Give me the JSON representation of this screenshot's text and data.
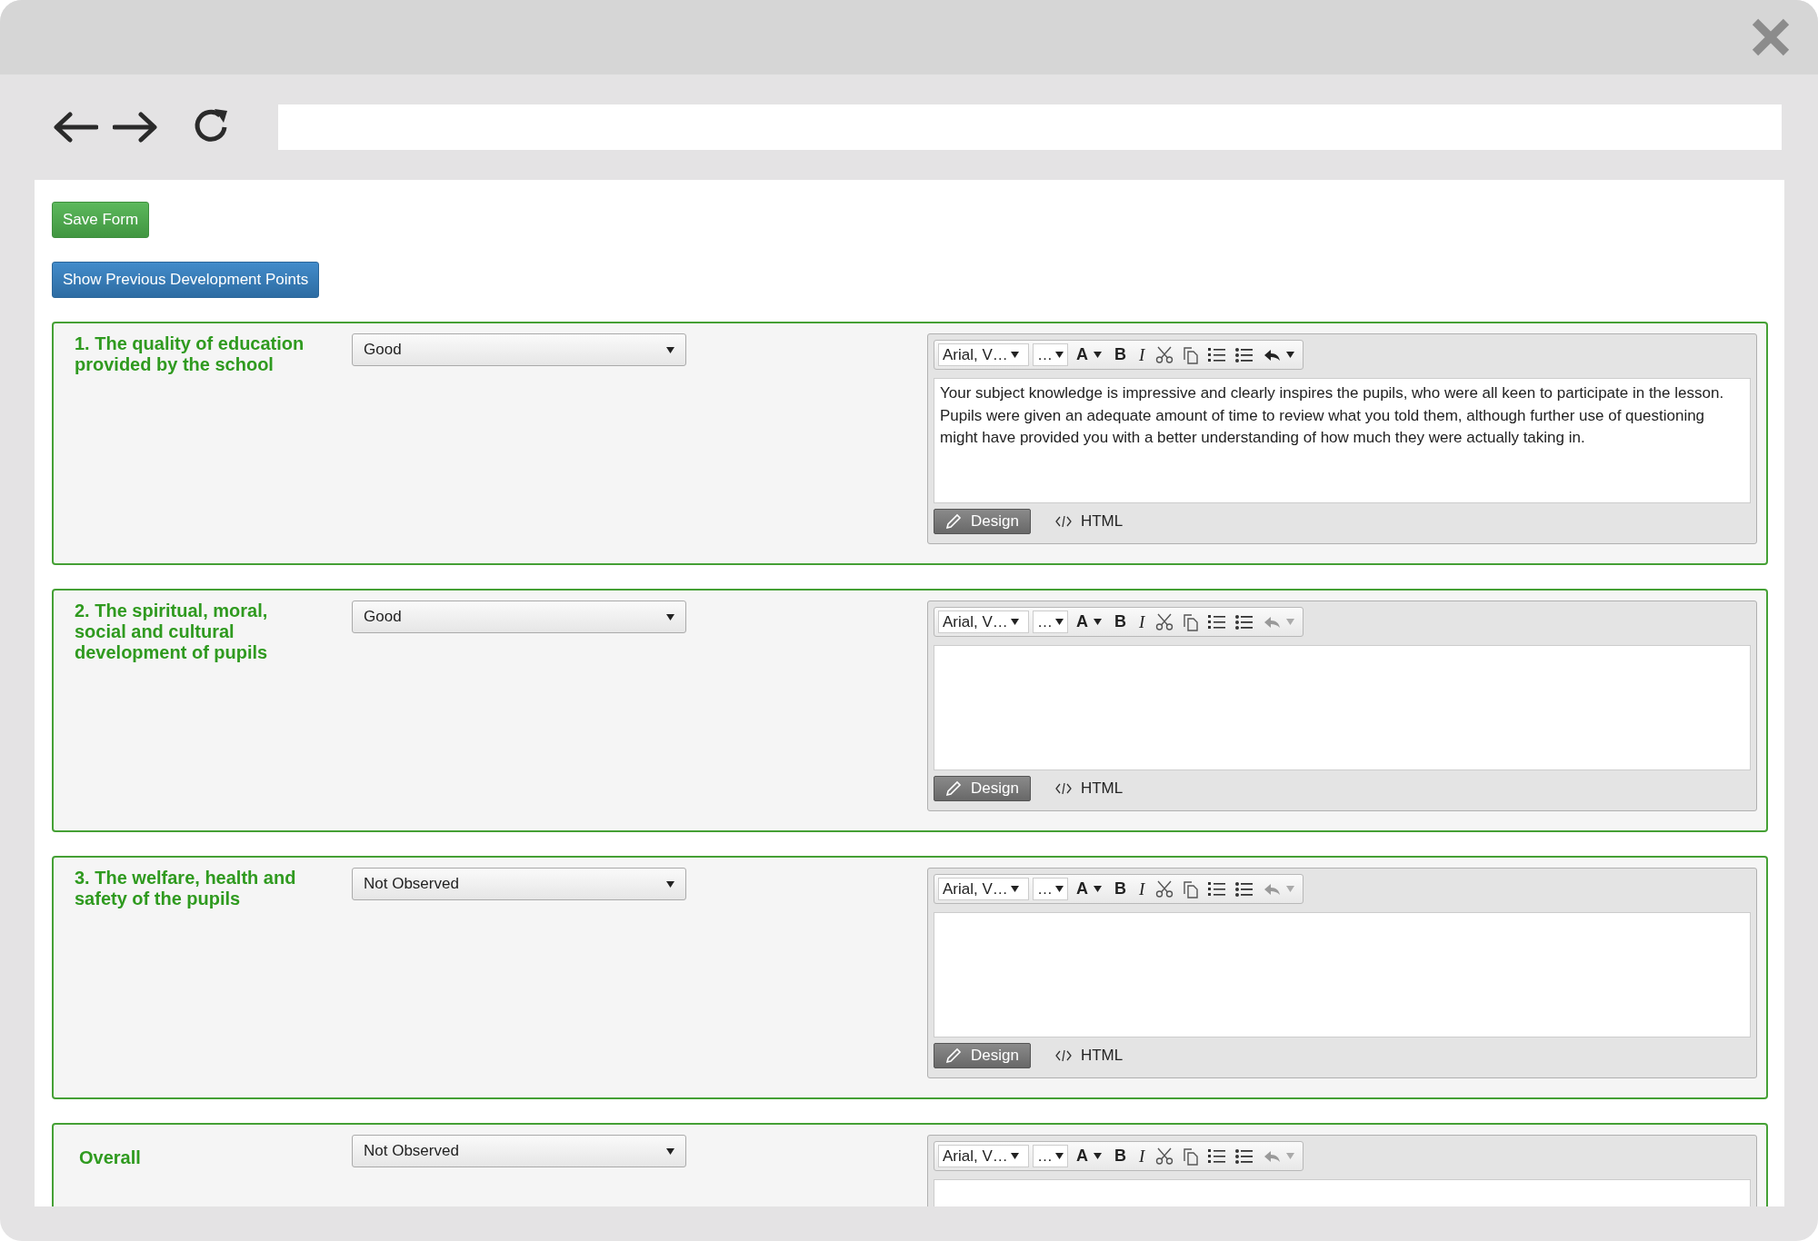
{
  "buttons": [
    {
      "label": "Save Form",
      "kind": "success"
    },
    {
      "label": "Show Previous Development Points",
      "kind": "primary"
    }
  ],
  "sections": [
    {
      "title": "1. The quality of education provided by the school",
      "rating": "Good",
      "editor": {
        "font": "Arial, V…",
        "size": "…",
        "tools": [
          {
            "kind": "font-color",
            "glyph": "A"
          },
          {
            "kind": "bold",
            "glyph": "B"
          },
          {
            "kind": "italic",
            "glyph": "I"
          },
          {
            "kind": "cut"
          },
          {
            "kind": "copy"
          },
          {
            "kind": "ordered-list"
          },
          {
            "kind": "bullet-list"
          },
          {
            "kind": "undo",
            "disabled": false
          }
        ],
        "text": "Your subject knowledge is impressive and clearly inspires the pupils, who were all keen to participate in the lesson. Pupils were given an adequate amount of time to review what you told them, although further use of questioning might have provided you with a better understanding of how much they were actually taking in.",
        "mode_tabs": [
          {
            "label": "Design",
            "selected": true
          },
          {
            "label": "HTML",
            "selected": false
          }
        ]
      }
    },
    {
      "title": "2. The spiritual, moral, social and cultural development of pupils",
      "rating": "Good",
      "editor": {
        "font": "Arial, V…",
        "size": "…",
        "tools": [
          {
            "kind": "font-color",
            "glyph": "A"
          },
          {
            "kind": "bold",
            "glyph": "B"
          },
          {
            "kind": "italic",
            "glyph": "I"
          },
          {
            "kind": "cut"
          },
          {
            "kind": "copy"
          },
          {
            "kind": "ordered-list"
          },
          {
            "kind": "bullet-list"
          },
          {
            "kind": "undo",
            "disabled": true
          }
        ],
        "mode_tabs": [
          {
            "label": "Design",
            "selected": true
          },
          {
            "label": "HTML",
            "selected": false
          }
        ]
      }
    },
    {
      "title": "3. The welfare, health and safety of the pupils",
      "rating": "Not Observed",
      "editor": {
        "font": "Arial, V…",
        "size": "…",
        "tools": [
          {
            "kind": "font-color",
            "glyph": "A"
          },
          {
            "kind": "bold",
            "glyph": "B"
          },
          {
            "kind": "italic",
            "glyph": "I"
          },
          {
            "kind": "cut"
          },
          {
            "kind": "copy"
          },
          {
            "kind": "ordered-list"
          },
          {
            "kind": "bullet-list"
          },
          {
            "kind": "undo",
            "disabled": true
          }
        ],
        "mode_tabs": [
          {
            "label": "Design",
            "selected": true
          },
          {
            "label": "HTML",
            "selected": false
          }
        ]
      }
    },
    {
      "title": "Overall",
      "rating": "Not Observed",
      "editor": {
        "font": "Arial, V…",
        "size": "…",
        "tools": [
          {
            "kind": "font-color",
            "glyph": "A"
          },
          {
            "kind": "bold",
            "glyph": "B"
          },
          {
            "kind": "italic",
            "glyph": "I"
          },
          {
            "kind": "cut"
          },
          {
            "kind": "copy"
          },
          {
            "kind": "ordered-list"
          },
          {
            "kind": "bullet-list"
          },
          {
            "kind": "undo",
            "disabled": true
          }
        ]
      }
    }
  ]
}
